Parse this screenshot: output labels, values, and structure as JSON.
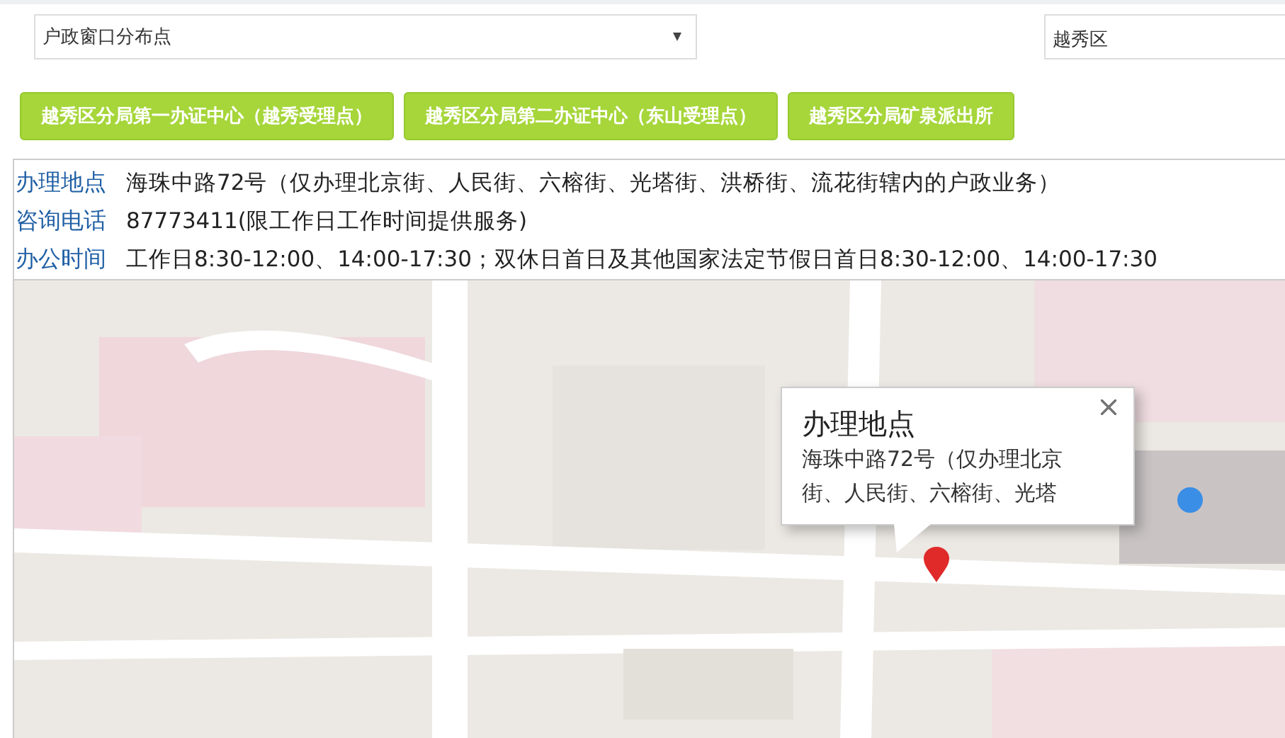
{
  "filters": {
    "category": {
      "value": "户政窗口分布点"
    },
    "district": {
      "value": "越秀区"
    }
  },
  "offices": [
    {
      "label": "越秀区分局第一办证中心（越秀受理点）"
    },
    {
      "label": "越秀区分局第二办证中心（东山受理点）"
    },
    {
      "label": "越秀区分局矿泉派出所"
    }
  ],
  "details": [
    {
      "label": "办理地点",
      "value": "海珠中路72号（仅办理北京街、人民街、六榕街、光塔街、洪桥街、流花街辖内的户政业务）"
    },
    {
      "label": "咨询电话",
      "value": "87773411(限工作日工作时间提供服务)"
    },
    {
      "label": "办公时间",
      "value": "工作日8:30-12:00、14:00-17:30；双休日首日及其他国家法定节假日首日8:30-12:00、14:00-17:30"
    }
  ],
  "map": {
    "popup": {
      "title": "办理地点",
      "text": "海珠中路72号（仅办理北京街、人民街、六榕街、光塔"
    }
  }
}
